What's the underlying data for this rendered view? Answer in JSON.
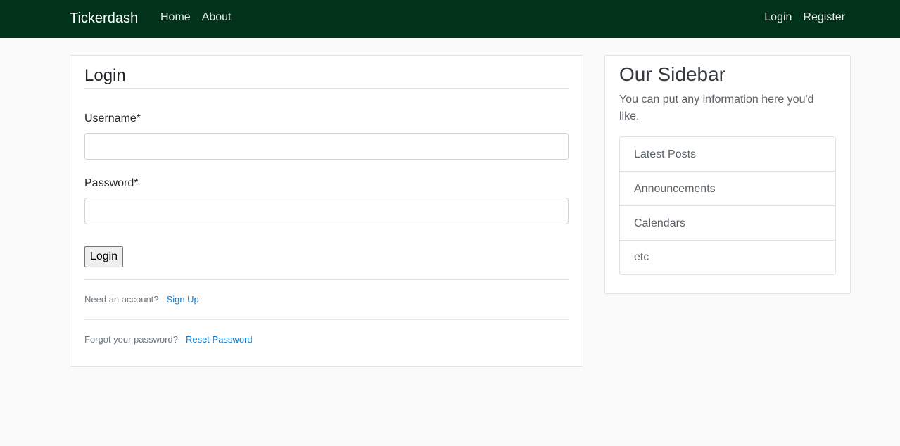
{
  "navbar": {
    "brand": "Tickerdash",
    "left_links": [
      "Home",
      "About"
    ],
    "right_links": [
      "Login",
      "Register"
    ]
  },
  "login_form": {
    "title": "Login",
    "username_label": "Username*",
    "username_value": "",
    "password_label": "Password*",
    "password_value": "",
    "submit_label": "Login",
    "signup_prompt": "Need an account?",
    "signup_link": "Sign Up",
    "reset_prompt": "Forgot your password?",
    "reset_link": "Reset Password"
  },
  "sidebar": {
    "title": "Our Sidebar",
    "text": "You can put any information here you'd like.",
    "items": [
      "Latest Posts",
      "Announcements",
      "Calendars",
      "etc"
    ]
  },
  "colors": {
    "navbar_bg": "#00331a",
    "link_blue": "#0b7dd6",
    "page_bg": "#fafafa"
  }
}
